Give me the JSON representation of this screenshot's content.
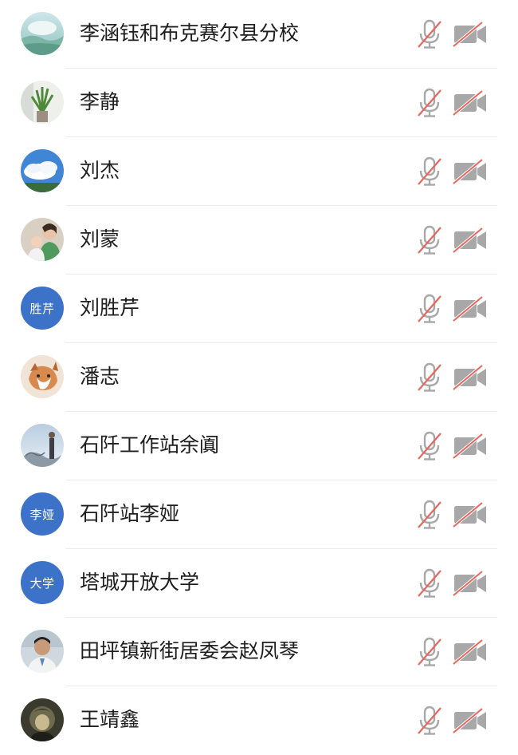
{
  "participants": [
    {
      "name": "李涵钰和布克赛尔县分校",
      "avatar": {
        "type": "photo",
        "icon": "landscape-photo-icon"
      },
      "mic_muted": true,
      "camera_off": true
    },
    {
      "name": "李静",
      "avatar": {
        "type": "photo",
        "icon": "plant-photo-icon"
      },
      "mic_muted": true,
      "camera_off": true
    },
    {
      "name": "刘杰",
      "avatar": {
        "type": "photo",
        "icon": "sky-photo-icon"
      },
      "mic_muted": true,
      "camera_off": true
    },
    {
      "name": "刘蒙",
      "avatar": {
        "type": "photo",
        "icon": "people-photo-icon"
      },
      "mic_muted": true,
      "camera_off": true
    },
    {
      "name": "刘胜芹",
      "avatar": {
        "type": "text",
        "text": "胜芹"
      },
      "mic_muted": true,
      "camera_off": true
    },
    {
      "name": "潘志",
      "avatar": {
        "type": "photo",
        "icon": "cat-photo-icon"
      },
      "mic_muted": true,
      "camera_off": true
    },
    {
      "name": "石阡工作站余阗",
      "avatar": {
        "type": "photo",
        "icon": "person-outdoor-photo-icon"
      },
      "mic_muted": true,
      "camera_off": true
    },
    {
      "name": "石阡站李娅",
      "avatar": {
        "type": "text",
        "text": "李娅"
      },
      "mic_muted": true,
      "camera_off": true
    },
    {
      "name": "塔城开放大学",
      "avatar": {
        "type": "text",
        "text": "大学"
      },
      "mic_muted": true,
      "camera_off": true
    },
    {
      "name": "田坪镇新街居委会赵凤琴",
      "avatar": {
        "type": "photo",
        "icon": "man-portrait-photo-icon"
      },
      "mic_muted": true,
      "camera_off": true
    },
    {
      "name": "王靖鑫",
      "avatar": {
        "type": "photo",
        "icon": "dark-portrait-photo-icon"
      },
      "mic_muted": true,
      "camera_off": true
    }
  ],
  "colors": {
    "avatar_text_bg": "#3d72c9",
    "icon_gray": "#a8a8a8",
    "muted_slash_red": "#e8665e",
    "name_text": "#1e1e1e",
    "divider": "#ececec"
  }
}
